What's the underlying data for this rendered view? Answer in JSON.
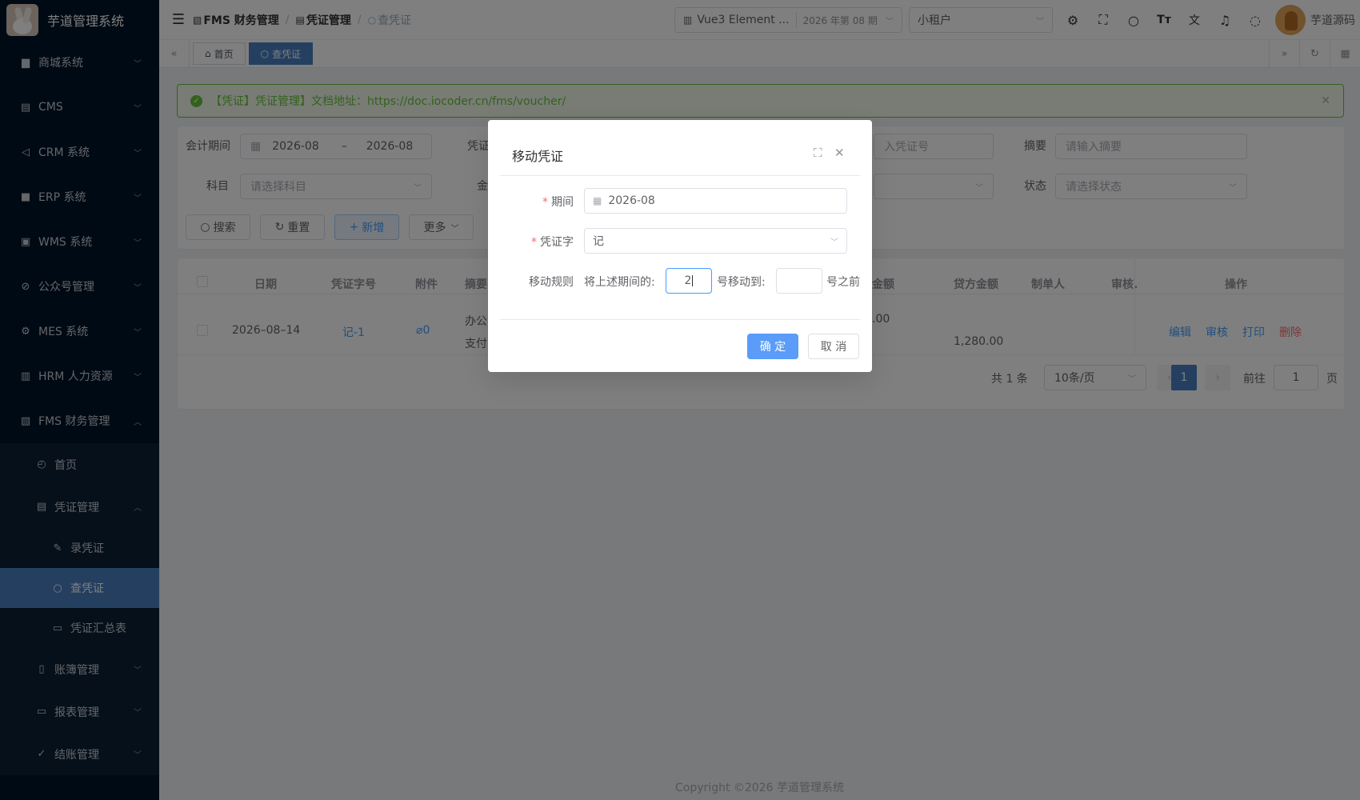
{
  "app": {
    "title": "芋道管理系统"
  },
  "sidebar": {
    "items": [
      {
        "label": "商城系统",
        "icon": "shop-icon"
      },
      {
        "label": "CMS",
        "icon": "document-icon"
      },
      {
        "label": "CRM 系统",
        "icon": "send-icon"
      },
      {
        "label": "ERP 系统",
        "icon": "erp-icon"
      },
      {
        "label": "WMS 系统",
        "icon": "box-icon"
      },
      {
        "label": "公众号管理",
        "icon": "compass-icon"
      },
      {
        "label": "MES 系统",
        "icon": "gear-icon"
      },
      {
        "label": "HRM 人力资源",
        "icon": "building-icon"
      },
      {
        "label": "FMS 财务管理",
        "icon": "finance-icon"
      }
    ],
    "fms_sub": [
      {
        "label": "首页"
      },
      {
        "label": "凭证管理"
      }
    ],
    "voucher_sub": [
      {
        "label": "录凭证"
      },
      {
        "label": "查凭证"
      },
      {
        "label": "凭证汇总表"
      }
    ],
    "fms_rest": [
      {
        "label": "账簿管理"
      },
      {
        "label": "报表管理"
      },
      {
        "label": "结账管理"
      }
    ]
  },
  "breadcrumb": [
    "FMS 财务管理",
    "凭证管理",
    "查凭证"
  ],
  "header": {
    "book_name": "Vue3 Element ...",
    "period": "2026 年第 08 期",
    "tenant": "小租户",
    "username": "芋道源码"
  },
  "tags": [
    "首页",
    "查凭证"
  ],
  "alert": {
    "text": "【凭证】凭证管理】文档地址：https://doc.iocoder.cn/fms/voucher/"
  },
  "filters": {
    "period_label": "会计期间",
    "period_start": "2026-08",
    "period_sep": "–",
    "period_end": "2026-08",
    "word_label": "凭证",
    "no_placeholder": "入凭证号",
    "summary_label": "摘要",
    "summary_placeholder": "请输入摘要",
    "subject_label": "科目",
    "subject_placeholder": "请选择科目",
    "amount_label": "金",
    "status_label": "状态",
    "status_placeholder": "请选择状态"
  },
  "buttons": {
    "search": "搜索",
    "reset": "重置",
    "add": "新增",
    "more": "更多"
  },
  "table": {
    "headers": {
      "date": "日期",
      "no": "凭证字号",
      "attach": "附件",
      "summary": "摘要",
      "debit": "金额",
      "credit": "贷方金额",
      "maker": "制单人",
      "auditor": "审核.",
      "ops": "操作"
    },
    "row": {
      "date": "2026–08–14",
      "no": "记-1",
      "attach": "0",
      "summary1": "办公",
      "summary2": "支付",
      "debit": ".00",
      "credit": "1,280.00",
      "ops": [
        "编辑",
        "审核",
        "打印",
        "删除"
      ]
    }
  },
  "pagination": {
    "total": "共 1 条",
    "size": "10条/页",
    "current": "1",
    "goto": "前往",
    "goto_value": "1",
    "page": "页"
  },
  "footer": "Copyright ©2026 芋道管理系统",
  "dialog": {
    "title": "移动凭证",
    "period_label": "期间",
    "period_value": "2026-08",
    "word_label": "凭证字",
    "word_value": "记",
    "rule_label": "移动规则",
    "rule_prefix": "将上述期间的:",
    "from_value": "2",
    "rule_middle": "号移动到:",
    "to_value": "",
    "rule_suffix": "号之前",
    "confirm": "确 定",
    "cancel": "取 消"
  },
  "colors": {
    "primary": "#409eff",
    "sidebar": "#001529",
    "active": "#4a7fc1",
    "success": "#67c23a",
    "danger": "#f56c6c"
  }
}
